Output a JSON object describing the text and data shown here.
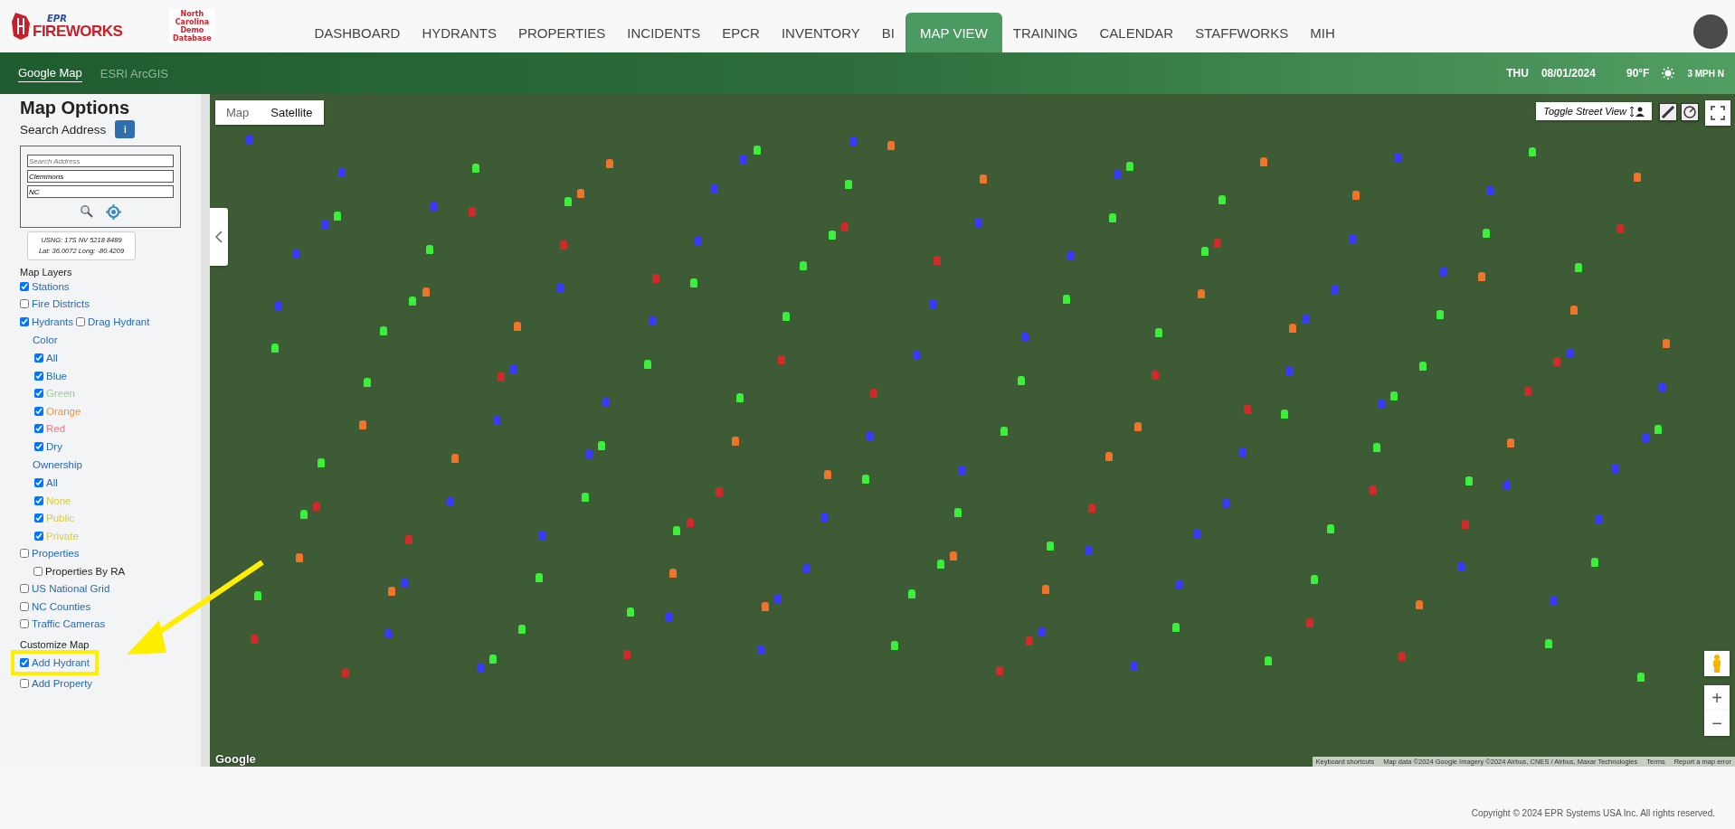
{
  "header": {
    "logo": {
      "top": "EPR",
      "bottom": "FIREWORKS"
    },
    "database_badge": "North Carolina Demo Database",
    "nav": [
      {
        "label": "DASHBOARD",
        "selected": false
      },
      {
        "label": "HYDRANTS",
        "selected": false
      },
      {
        "label": "PROPERTIES",
        "selected": false
      },
      {
        "label": "INCIDENTS",
        "selected": false
      },
      {
        "label": "EPCR",
        "selected": false
      },
      {
        "label": "INVENTORY",
        "selected": false
      },
      {
        "label": "BI",
        "selected": false
      },
      {
        "label": "MAP VIEW",
        "selected": true
      },
      {
        "label": "TRAINING",
        "selected": false
      },
      {
        "label": "CALENDAR",
        "selected": false
      },
      {
        "label": "STAFFWORKS",
        "selected": false
      },
      {
        "label": "MIH",
        "selected": false
      }
    ]
  },
  "subnav": {
    "tabs": [
      {
        "label": "Google Map",
        "selected": true
      },
      {
        "label": "ESRI ArcGIS",
        "selected": false
      }
    ],
    "day": "THU",
    "date": "08/01/2024",
    "temperature": "90°F",
    "wind": "3 MPH N"
  },
  "sidebar": {
    "title": "Map Options",
    "search_label": "Search Address",
    "info_button": "i",
    "fields": [
      {
        "placeholder": "Search Address"
      },
      {
        "value": "Clemmons"
      },
      {
        "value": "NC"
      }
    ],
    "coordinates": [
      "USNG: 17S NV 5218 8489",
      "Lat: 36.0072 Long: -80.4209"
    ],
    "layers_title": "Map Layers",
    "layers": [
      {
        "label": "Stations",
        "checked": true
      },
      {
        "label": "Fire Districts",
        "checked": false
      },
      {
        "label": "Hydrants",
        "checked": true,
        "extra": {
          "label": "Drag Hydrant",
          "checked": false
        },
        "groups": [
          {
            "title": "Color",
            "items": [
              {
                "label": "All",
                "checked": true,
                "color": "#2a6ab3"
              },
              {
                "label": "Blue",
                "checked": true,
                "color": "#2a6ab3"
              },
              {
                "label": "Green",
                "checked": true,
                "color": "#8fd48f"
              },
              {
                "label": "Orange",
                "checked": true,
                "color": "#f0923a"
              },
              {
                "label": "Red",
                "checked": true,
                "color": "#e07a86"
              },
              {
                "label": "Dry",
                "checked": true,
                "color": "#2a6ab3"
              }
            ]
          },
          {
            "title": "Ownership",
            "items": [
              {
                "label": "All",
                "checked": true,
                "color": "#2a6ab3"
              },
              {
                "label": "None",
                "checked": true,
                "color": "#d8cc3a"
              },
              {
                "label": "Public",
                "checked": true,
                "color": "#d8cc3a"
              },
              {
                "label": "Private",
                "checked": true,
                "color": "#d8cc3a"
              }
            ]
          }
        ]
      },
      {
        "label": "Properties",
        "checked": false,
        "children": [
          {
            "label": "Properties By RA",
            "checked": false
          }
        ]
      },
      {
        "label": "US National Grid",
        "checked": false
      },
      {
        "label": "NC Counties",
        "checked": false
      },
      {
        "label": "Traffic Cameras",
        "checked": false
      }
    ],
    "customize_title": "Customize Map",
    "customize": [
      {
        "label": "Add Hydrant",
        "checked": true,
        "highlighted": true
      },
      {
        "label": "Add Property",
        "checked": false,
        "highlighted": false
      }
    ]
  },
  "map": {
    "types": [
      {
        "label": "Map",
        "selected": false
      },
      {
        "label": "Satellite",
        "selected": true
      }
    ],
    "street_view": "Toggle Street View",
    "zoom_in": "+",
    "zoom_out": "−",
    "google": "Google",
    "attribution": [
      "Keyboard shortcuts",
      "Map data ©2024 Google Imagery ©2024 Airbus, CNES / Airbus, Maxar Technologies",
      "Terms",
      "Report a map error"
    ]
  },
  "footer": "Copyright © 2024 EPR Systems USA Inc. All rights reserved."
}
